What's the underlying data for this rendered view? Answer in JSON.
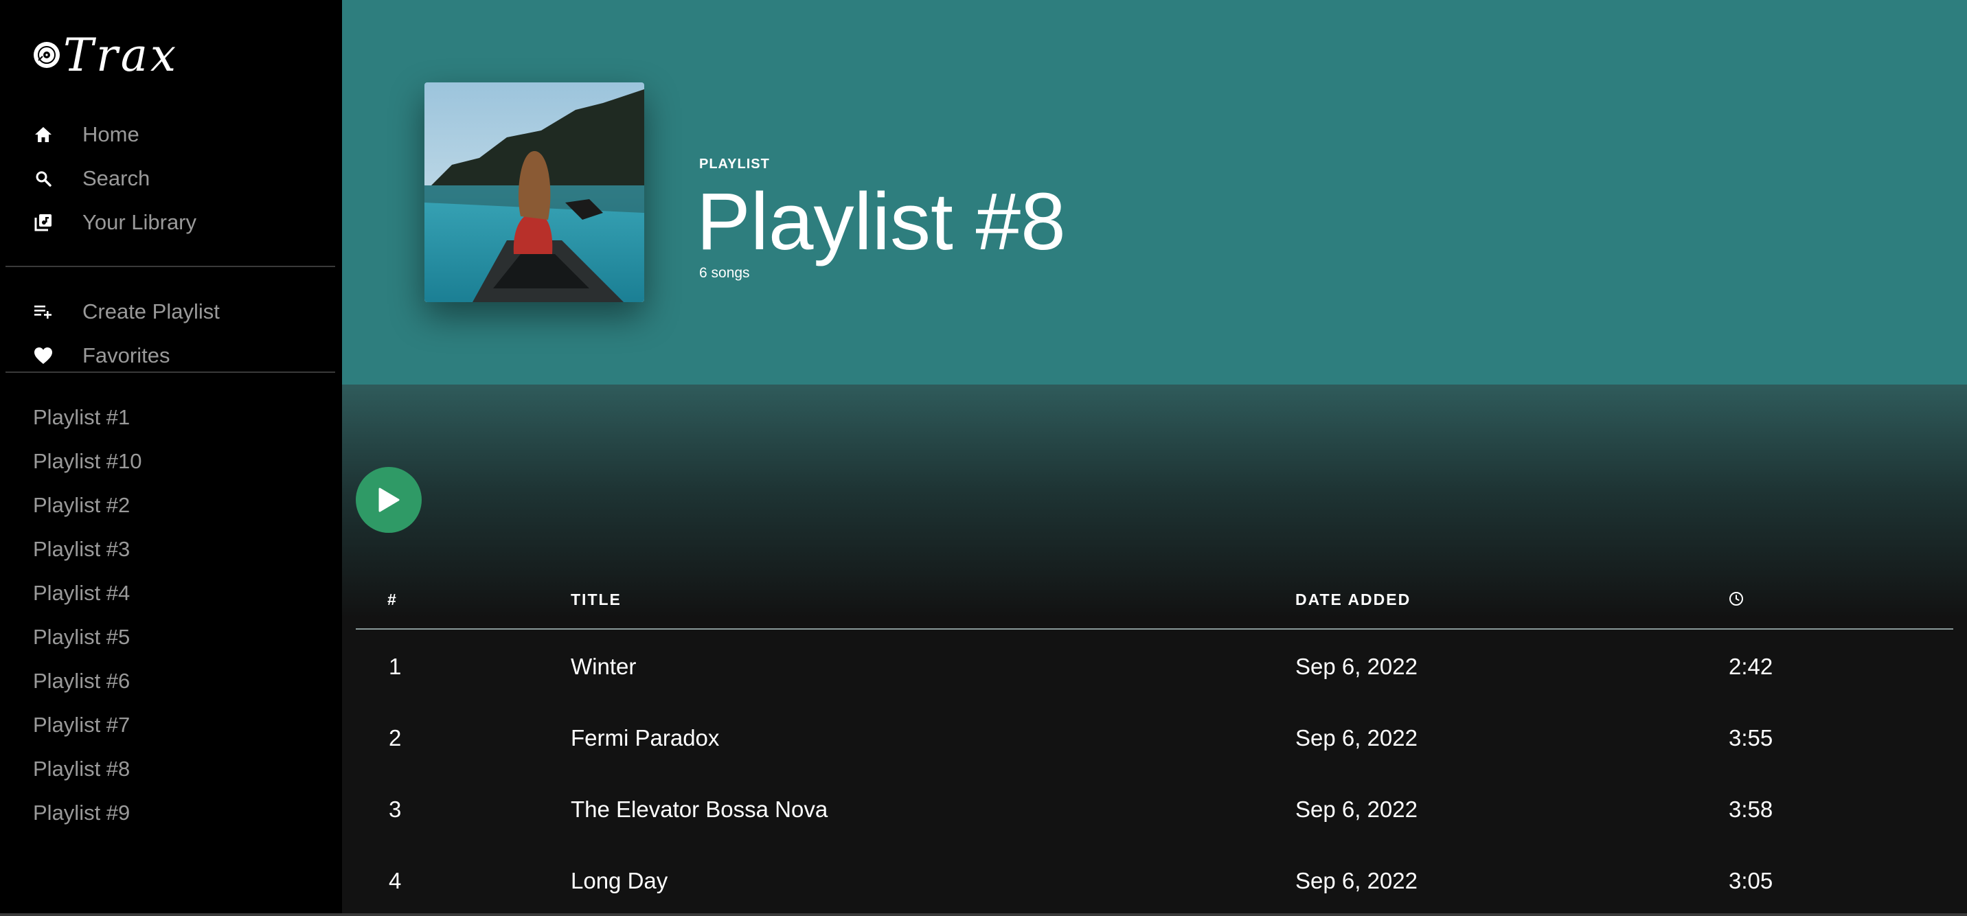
{
  "app": {
    "logo_text": "Trax"
  },
  "nav": {
    "home": "Home",
    "search": "Search",
    "library": "Your Library",
    "create_playlist": "Create Playlist",
    "favorites": "Favorites"
  },
  "playlists": [
    "Playlist #1",
    "Playlist #10",
    "Playlist #2",
    "Playlist #3",
    "Playlist #4",
    "Playlist #5",
    "Playlist #6",
    "Playlist #7",
    "Playlist #8",
    "Playlist #9"
  ],
  "header": {
    "type_label": "PLAYLIST",
    "title": "Playlist #8",
    "song_count": "6 songs",
    "bg_color": "#2e7e7e"
  },
  "table": {
    "columns": {
      "num": "#",
      "title": "TITLE",
      "date": "DATE ADDED"
    },
    "rows": [
      {
        "num": "1",
        "title": "Winter",
        "date": "Sep 6, 2022",
        "duration": "2:42"
      },
      {
        "num": "2",
        "title": "Fermi Paradox",
        "date": "Sep 6, 2022",
        "duration": "3:55"
      },
      {
        "num": "3",
        "title": "The Elevator Bossa Nova",
        "date": "Sep 6, 2022",
        "duration": "3:58"
      },
      {
        "num": "4",
        "title": "Long Day",
        "date": "Sep 6, 2022",
        "duration": "3:05"
      }
    ]
  },
  "colors": {
    "accent": "#2f9a66",
    "sidebar_text": "#9a9a9a"
  },
  "icons": [
    "vinyl-icon",
    "home-icon",
    "search-icon",
    "library-icon",
    "playlist-add-icon",
    "heart-icon",
    "play-icon",
    "clock-icon"
  ]
}
